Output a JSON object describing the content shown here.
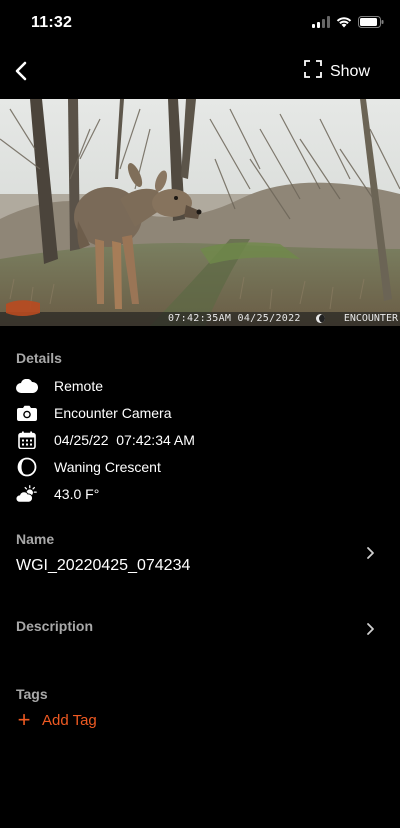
{
  "status_bar": {
    "time": "11:32"
  },
  "nav": {
    "show_label": "Show"
  },
  "photo": {
    "stamp": "07:42:35AM 04/25/2022",
    "brand": "ENCOUNTER"
  },
  "details": {
    "heading": "Details",
    "items": [
      {
        "icon": "cloud-icon",
        "text": "Remote"
      },
      {
        "icon": "camera-icon",
        "text": "Encounter Camera"
      },
      {
        "icon": "calendar-icon",
        "text": "04/25/22  07:42:34 AM"
      },
      {
        "icon": "moon-icon",
        "text": "Waning Crescent"
      },
      {
        "icon": "weather-icon",
        "text": "43.0 F°"
      }
    ]
  },
  "name": {
    "heading": "Name",
    "value": "WGI_20220425_074234"
  },
  "description": {
    "heading": "Description",
    "value": ""
  },
  "tags": {
    "heading": "Tags",
    "add_label": "Add Tag"
  },
  "colors": {
    "accent": "#f05a22",
    "background": "#000000",
    "muted": "#a8a8a8"
  }
}
